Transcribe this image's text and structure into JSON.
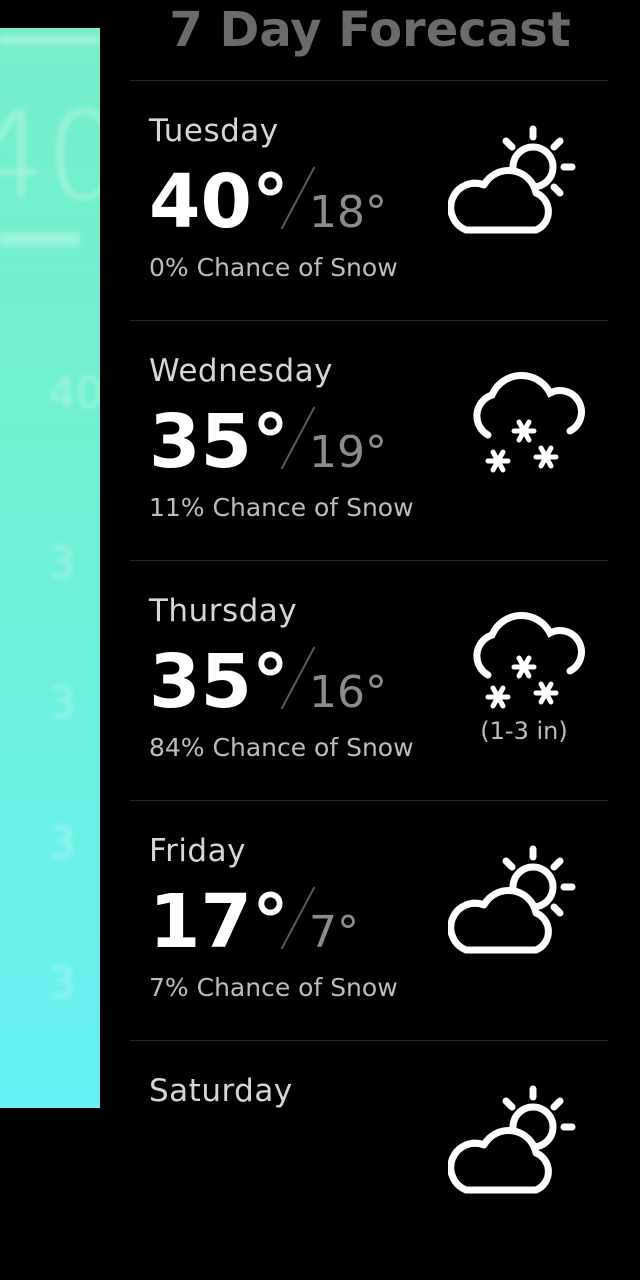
{
  "title": "7 Day Forecast",
  "colors": {
    "background": "#000000",
    "side_panel_top": "#74eecb",
    "side_panel_bottom": "#66f0f2",
    "title": "#6b6b6b"
  },
  "days": [
    {
      "name": "Tuesday",
      "high": "40°",
      "low": "18°",
      "chance": "0% Chance of Snow",
      "icon": "partly-cloudy-icon",
      "accumulation": ""
    },
    {
      "name": "Wednesday",
      "high": "35°",
      "low": "19°",
      "chance": "11% Chance of Snow",
      "icon": "snow-icon",
      "accumulation": ""
    },
    {
      "name": "Thursday",
      "high": "35°",
      "low": "16°",
      "chance": "84% Chance of Snow",
      "icon": "snow-icon",
      "accumulation": "(1-3 in)"
    },
    {
      "name": "Friday",
      "high": "17°",
      "low": "7°",
      "chance": "7% Chance of Snow",
      "icon": "partly-cloudy-icon",
      "accumulation": ""
    },
    {
      "name": "Saturday",
      "high": "",
      "low": "",
      "chance": "",
      "icon": "partly-cloudy-icon",
      "accumulation": ""
    }
  ]
}
